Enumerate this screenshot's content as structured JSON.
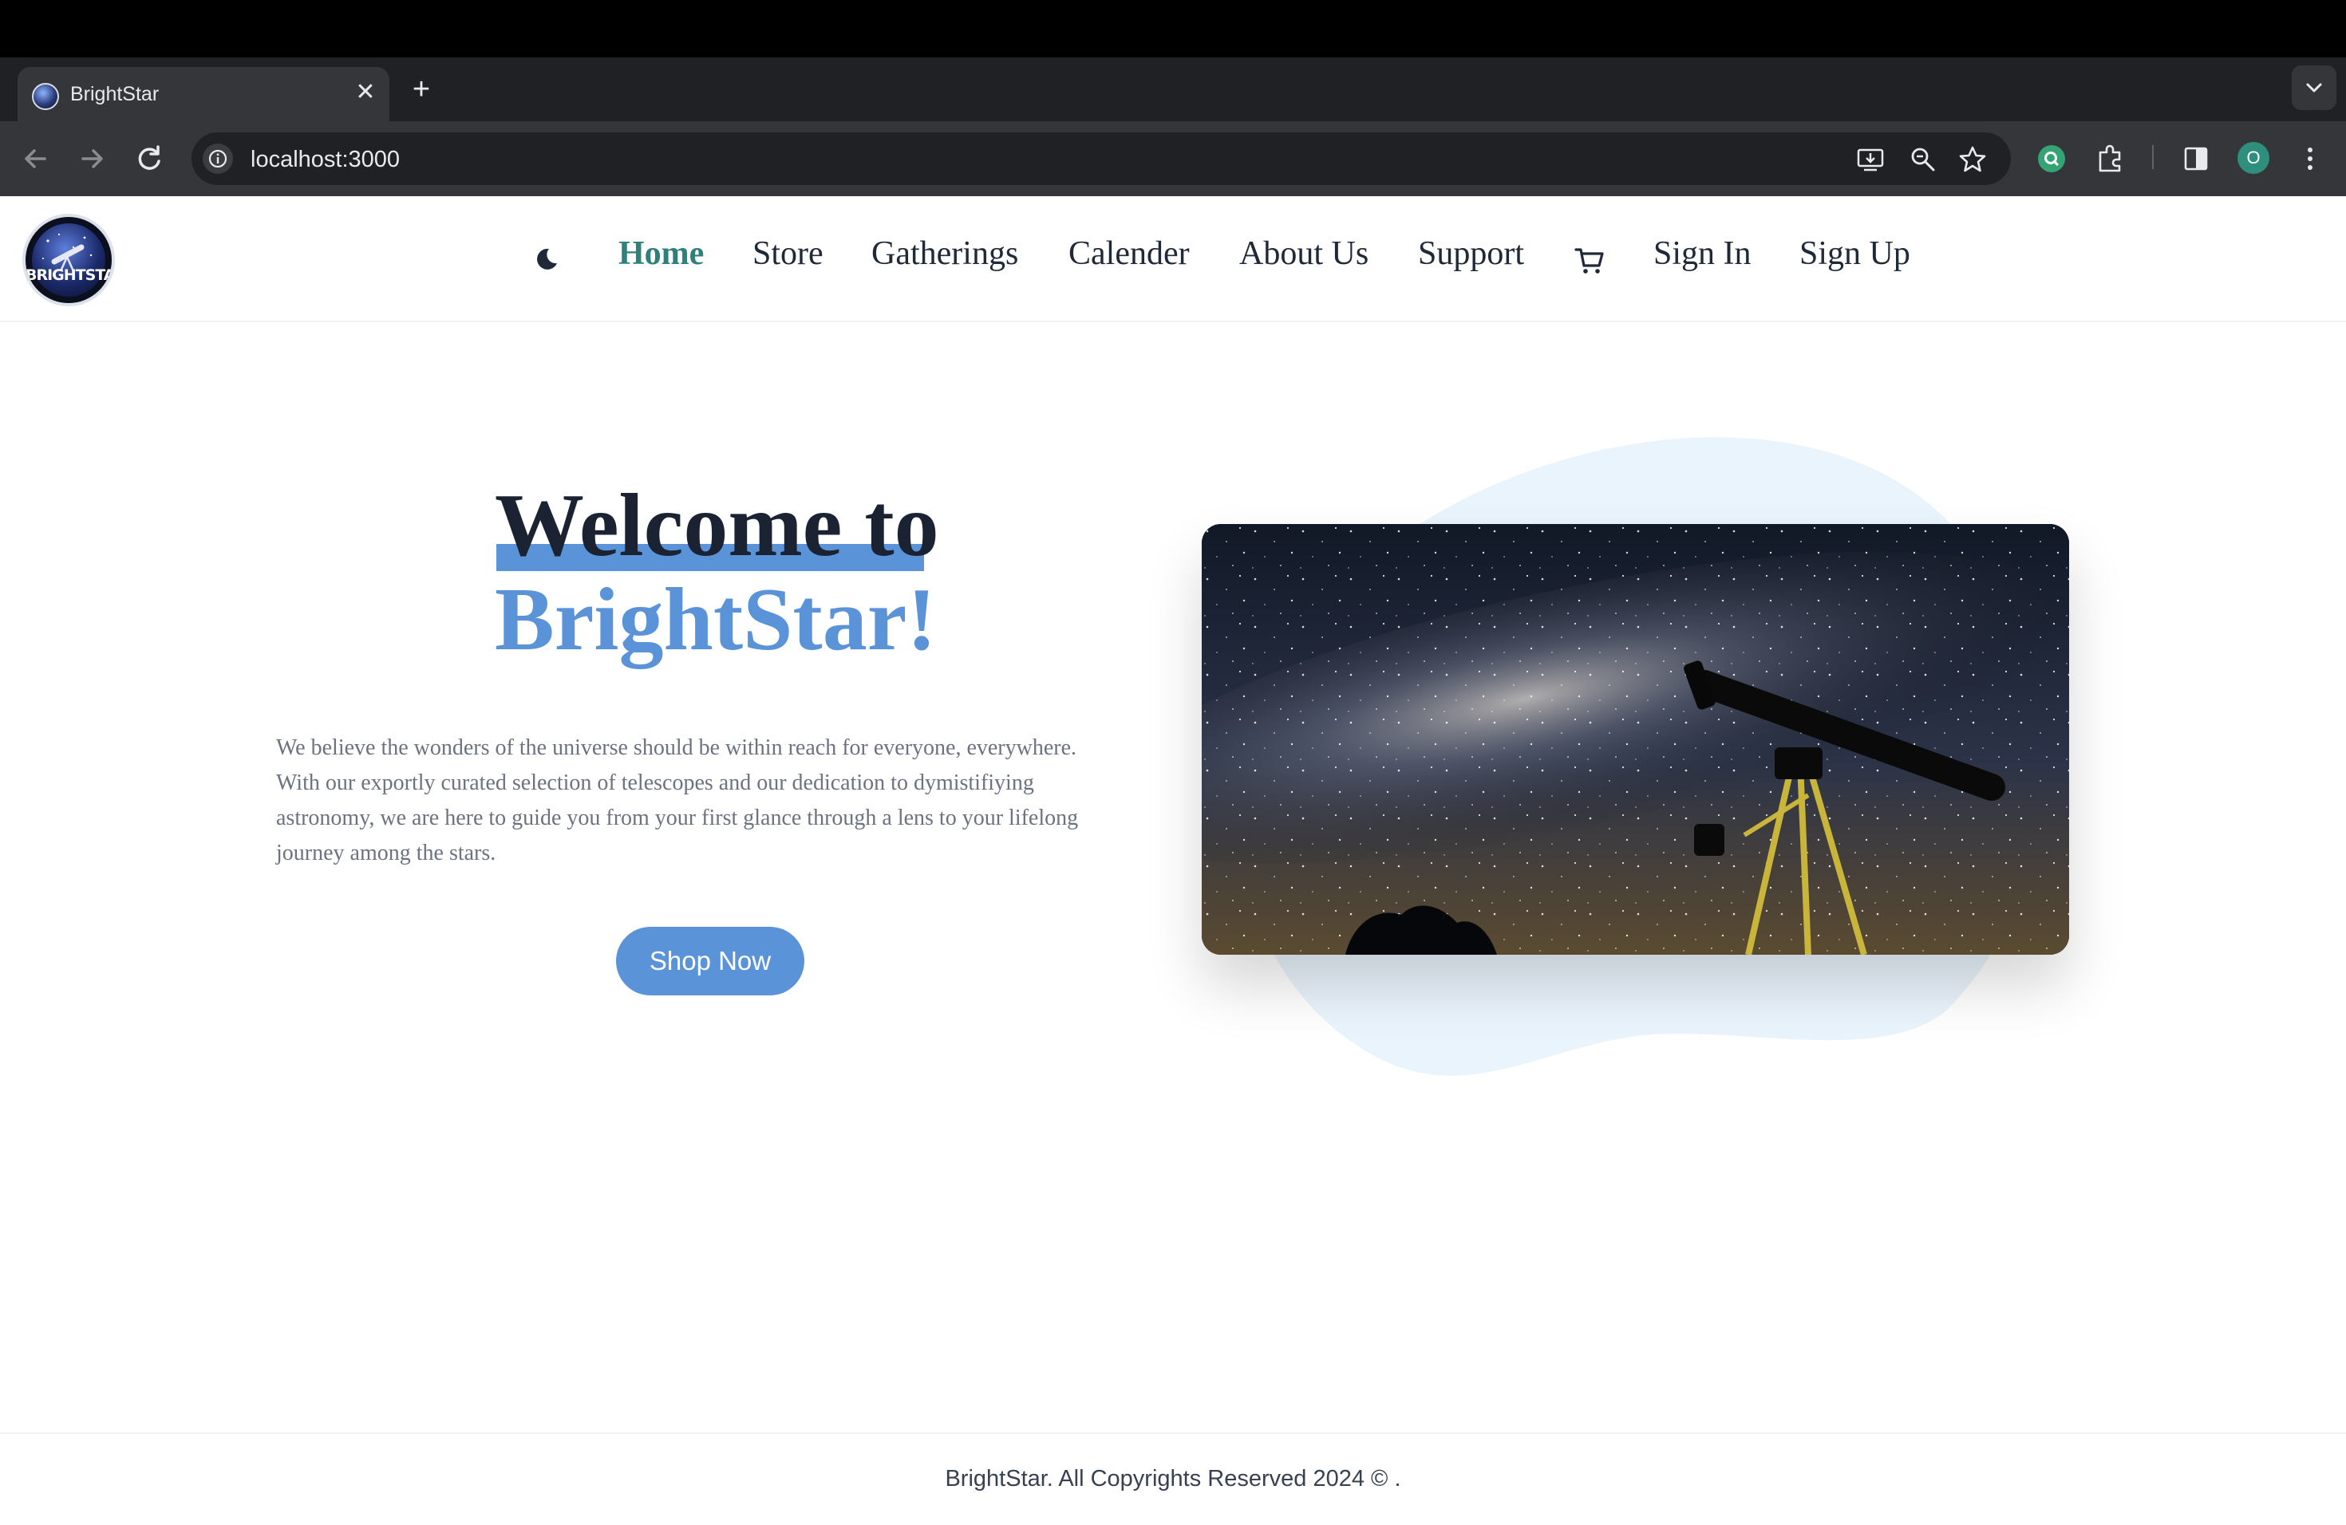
{
  "browser": {
    "tab_title": "BrightStar",
    "url": "localhost:3000",
    "profile_initial": "O"
  },
  "navbar": {
    "logo_text": "BRIGHTSTAR",
    "theme_toggle_icon": "moon-icon",
    "items": [
      {
        "label": "Home",
        "active": true
      },
      {
        "label": "Store"
      },
      {
        "label": "Gatherings"
      },
      {
        "label": "Calender"
      },
      {
        "label": "About Us"
      },
      {
        "label": "Support"
      }
    ],
    "cart_icon": "cart-icon",
    "sign_in": "Sign In",
    "sign_up": "Sign Up"
  },
  "hero": {
    "title_line1": "Welcome to",
    "title_line2": "BrightStar!",
    "description": "We believe the wonders of the universe should be within reach for everyone, everywhere. With our exportly curated selection of telescopes and our dedication to dymistifiying astronomy, we are here to guide you from your first glance through a lens to your lifelong journey among the stars.",
    "cta": "Shop Now"
  },
  "footer": {
    "text": "BrightStar. All Copyrights Reserved 2024 © ."
  },
  "colors": {
    "accent": "#5b93d9",
    "active_nav": "#2f7f7a",
    "heading": "#1b2333",
    "blob": "#eaf4fc"
  }
}
